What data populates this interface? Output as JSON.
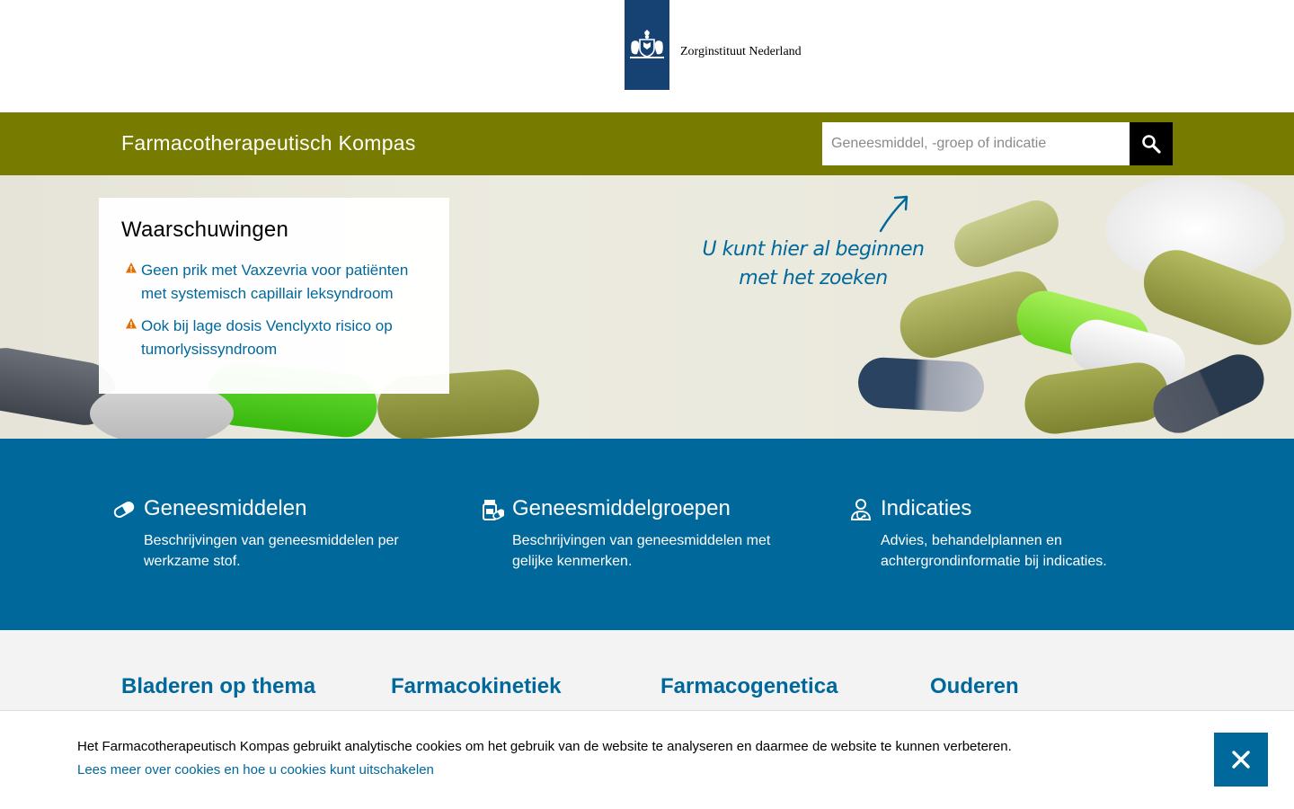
{
  "header": {
    "org_name": "Zorginstituut Nederland",
    "logo_icon": "coat-of-arms-icon"
  },
  "navbar": {
    "site_title": "Farmacotherapeutisch Kompas",
    "search_placeholder": "Geneesmiddel, -groep of indicatie",
    "search_icon": "search-icon",
    "bar_color": "#777b00"
  },
  "warnings": {
    "title": "Waarschuwingen",
    "icon": "warning-triangle-icon",
    "items": [
      {
        "label": "Geen prik met Vaxzevria voor patiënten met systemisch capillair leksyndroom"
      },
      {
        "label": "Ook bij lage dosis Venclyxto risico op tumorlysissyndroom"
      }
    ]
  },
  "hero": {
    "hint": "U kunt hier al beginnen met het zoeken"
  },
  "categories": [
    {
      "icon": "pill-icon",
      "title": "Geneesmiddelen",
      "description": "Beschrijvingen van geneesmiddelen per werkzame stof."
    },
    {
      "icon": "medicine-bottle-icon",
      "title": "Geneesmiddelgroepen",
      "description": "Beschrijvingen van geneesmiddelen met gelijke kenmerken."
    },
    {
      "icon": "doctor-icon",
      "title": "Indicaties",
      "description": "Advies, behandelplannen en achtergrondinformatie bij indicaties."
    }
  ],
  "themes": [
    {
      "title": "Bladeren op thema"
    },
    {
      "title": "Farmacokinetiek"
    },
    {
      "title": "Farmacogenetica"
    },
    {
      "title": "Ouderen"
    }
  ],
  "cookie_banner": {
    "text": "Het Farmacotherapeutisch Kompas gebruikt analytische cookies om het gebruik van de website te analyseren en daarmee de website te kunnen verbeteren.",
    "link": "Lees meer over cookies en hoe u cookies kunt uitschakelen",
    "close_icon": "close-icon"
  },
  "colors": {
    "brand_blue": "#01689b",
    "olive": "#777b00",
    "logo_blue": "#154273",
    "warning_orange": "#e17000"
  }
}
